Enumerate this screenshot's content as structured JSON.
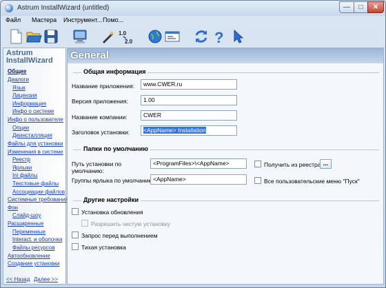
{
  "window": {
    "title": "Astrum InstallWizard (untitled)"
  },
  "menu": [
    "Файл",
    "Мастера",
    "Инструмент...",
    "Помо..."
  ],
  "toolbar": [
    {
      "icon": "new-document-icon"
    },
    {
      "icon": "open-folder-icon"
    },
    {
      "icon": "save-disk-icon"
    },
    {
      "icon": "computer-icon"
    },
    {
      "icon": "magic-wand-icon"
    },
    {
      "icon": "version-upgrade-icon",
      "text_from": "1.0",
      "text_to": "2.0"
    },
    {
      "icon": "globe-icon"
    },
    {
      "icon": "settings-dialog-icon"
    },
    {
      "icon": "refresh-icon"
    },
    {
      "icon": "help-icon",
      "text": "?"
    },
    {
      "icon": "cursor-icon"
    }
  ],
  "sidebar": {
    "title": "Astrum InstallWizard",
    "items": [
      {
        "label": "Общие",
        "active": true
      },
      {
        "label": "Диалоги"
      },
      {
        "label": "Язык"
      },
      {
        "label": "Лицензия"
      },
      {
        "label": "Информация"
      },
      {
        "label": "Инфо о системе"
      },
      {
        "label": "Инфо о пользователе"
      },
      {
        "label": "Опции"
      },
      {
        "label": "Деинсталляция"
      },
      {
        "label": "Файлы для установки"
      },
      {
        "label": "Изменения в системе"
      },
      {
        "label": "Реестр"
      },
      {
        "label": "Ярлыки"
      },
      {
        "label": "Ini файлы"
      },
      {
        "label": "Текстовые файлы"
      },
      {
        "label": "Ассоциации файлов"
      },
      {
        "label": "Системные требования"
      },
      {
        "label": "Фон"
      },
      {
        "label": "Слайд-шоу"
      },
      {
        "label": "Расширенные"
      },
      {
        "label": "Переменные"
      },
      {
        "label": "Interact. и оболочка"
      },
      {
        "label": "Файлы ресурсов"
      },
      {
        "label": "Автообновление"
      },
      {
        "label": "Создание установки"
      }
    ],
    "back": "<< Назад",
    "next": "Далее >>"
  },
  "main": {
    "title": "General",
    "general_info": {
      "title": "Общая информация",
      "app_name_label": "Название приложения:",
      "app_name_value": "www.CWER.ru",
      "version_label": "Версия приложения:",
      "version_value": "1.00",
      "company_label": "Название компании:",
      "company_value": "CWER",
      "install_title_label": "Заголовок установки:",
      "install_title_value": "<AppName> Installation"
    },
    "default_folders": {
      "title": "Папки по умолчанию",
      "install_path_label": "Путь установки по умолчанию:",
      "install_path_value": "<ProgramFiles>\\<AppName>",
      "from_registry_label": "Получить из реестра",
      "dots": "...",
      "shortcut_group_label": "Группы ярлыка по умолчанию:",
      "shortcut_group_value": "<AppName>",
      "all_users_label": "Все пользовательские меню \"Пуск\""
    },
    "other": {
      "title": "Другие настройки",
      "update_install_label": "Установка обновления",
      "allow_clean_label": "Разрешить чистую установку",
      "prompt_label": "Запрос перед выполнением",
      "silent_label": "Тихая установка"
    }
  }
}
